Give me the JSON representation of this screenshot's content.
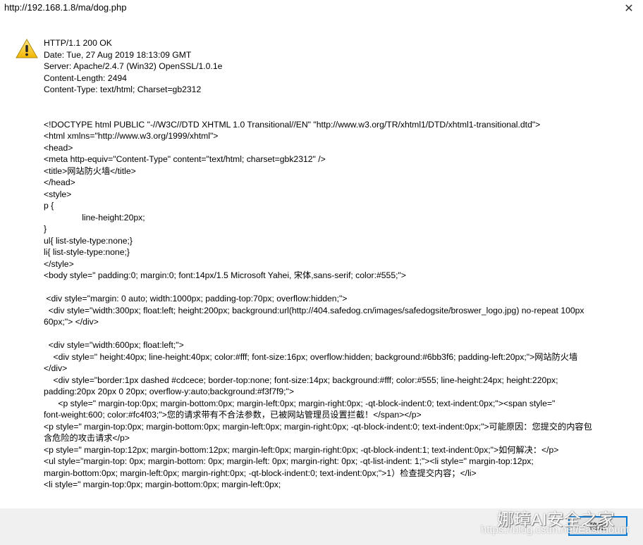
{
  "dialog": {
    "title": "http://192.168.1.8/ma/dog.php",
    "close_icon": "close-icon",
    "icon": "warning-icon",
    "ok_label": "确定"
  },
  "message_lines": [
    "HTTP/1.1 200 OK",
    "Date: Tue, 27 Aug 2019 18:13:09 GMT",
    "Server: Apache/2.4.7 (Win32) OpenSSL/1.0.1e",
    "Content-Length: 2494",
    "Content-Type: text/html; Charset=gb2312",
    "",
    "",
    "<!DOCTYPE html PUBLIC \"-//W3C//DTD XHTML 1.0 Transitional//EN\" \"http://www.w3.org/TR/xhtml1/DTD/xhtml1-transitional.dtd\">",
    "<html xmlns=\"http://www.w3.org/1999/xhtml\">",
    "<head>",
    "<meta http-equiv=\"Content-Type\" content=\"text/html; charset=gbk2312\" />",
    "<title>网站防火墙</title>",
    "</head>",
    "<style>",
    "p {",
    "                line-height:20px;",
    "}",
    "ul{ list-style-type:none;}",
    "li{ list-style-type:none;}",
    "</style>",
    "<body style=\" padding:0; margin:0; font:14px/1.5 Microsoft Yahei, 宋体,sans-serif; color:#555;\">",
    "",
    " <div style=\"margin: 0 auto; width:1000px; padding-top:70px; overflow:hidden;\">",
    "  <div style=\"width:300px; float:left; height:200px; background:url(http://404.safedog.cn/images/safedogsite/broswer_logo.jpg) no-repeat 100px",
    "60px;\"> </div>",
    "",
    "  <div style=\"width:600px; float:left;\">",
    "    <div style=\" height:40px; line-height:40px; color:#fff; font-size:16px; overflow:hidden; background:#6bb3f6; padding-left:20px;\">网站防火墙",
    "</div>",
    "    <div style=\"border:1px dashed #cdcece; border-top:none; font-size:14px; background:#fff; color:#555; line-height:24px; height:220px;",
    "padding:20px 20px 0 20px; overflow-y:auto;background:#f3f7f9;\">",
    "      <p style=\" margin-top:0px; margin-bottom:0px; margin-left:0px; margin-right:0px; -qt-block-indent:0; text-indent:0px;\"><span style=\"",
    "font-weight:600; color:#fc4f03;\">您的请求带有不合法参数，已被网站管理员设置拦截！</span></p>",
    "<p style=\" margin-top:0px; margin-bottom:0px; margin-left:0px; margin-right:0px; -qt-block-indent:0; text-indent:0px;\">可能原因：您提交的内容包",
    "含危险的攻击请求</p>",
    "<p style=\" margin-top:12px; margin-bottom:12px; margin-left:0px; margin-right:0px; -qt-block-indent:1; text-indent:0px;\">如何解决：</p>",
    "<ul style=\"margin-top: 0px; margin-bottom: 0px; margin-left: 0px; margin-right: 0px; -qt-list-indent: 1;\"><li style=\" margin-top:12px;",
    "margin-bottom:0px; margin-left:0px; margin-right:0px; -qt-block-indent:0; text-indent:0px;\">1）检查提交内容；</li>",
    "<li style=\" margin-top:0px; margin-bottom:0px; margin-left:0px;"
  ],
  "watermark": {
    "brand": "娜璋AI安全之家",
    "url": "https://blog.csdn.net/Eastmount"
  }
}
